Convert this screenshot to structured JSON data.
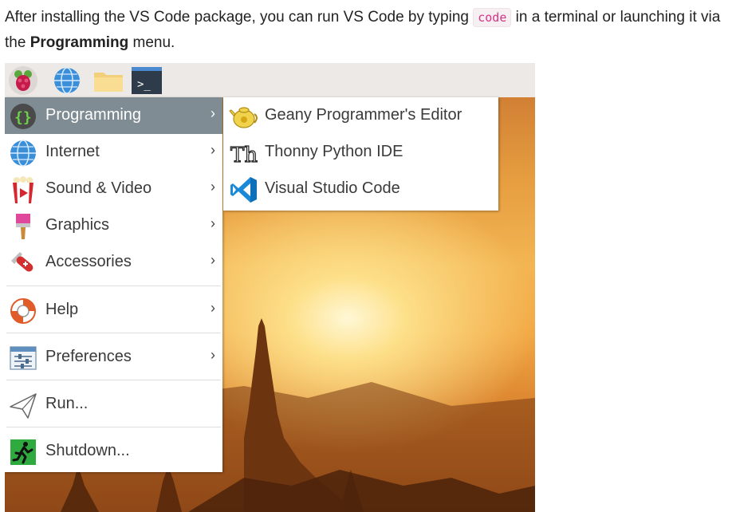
{
  "article": {
    "text_before_code": "After installing the VS Code package, you can run VS Code by typing ",
    "code": "code",
    "text_after_code": " in a terminal or launching it via the ",
    "menu_name": "Programming",
    "text_end": " menu."
  },
  "taskbar": {
    "icons": [
      "raspberry-pi-icon",
      "globe-icon",
      "folder-icon",
      "terminal-icon"
    ],
    "terminal_glyph": ">_"
  },
  "main_menu": {
    "items": [
      {
        "label": "Programming",
        "icon": "braces-icon",
        "has_submenu": true,
        "active": true
      },
      {
        "label": "Internet",
        "icon": "globe-icon",
        "has_submenu": true
      },
      {
        "label": "Sound & Video",
        "icon": "popcorn-icon",
        "has_submenu": true
      },
      {
        "label": "Graphics",
        "icon": "paintbrush-icon",
        "has_submenu": true
      },
      {
        "label": "Accessories",
        "icon": "swiss-knife-icon",
        "has_submenu": true
      },
      {
        "label": "Help",
        "icon": "lifebuoy-icon",
        "has_submenu": true
      },
      {
        "label": "Preferences",
        "icon": "sliders-icon",
        "has_submenu": true
      },
      {
        "label": "Run...",
        "icon": "paper-plane-icon",
        "has_submenu": false
      },
      {
        "label": "Shutdown...",
        "icon": "exit-running-man-icon",
        "has_submenu": false
      }
    ],
    "chevron": "›",
    "braces_glyph": "{}"
  },
  "submenu": {
    "items": [
      {
        "label": "Geany Programmer's Editor",
        "icon": "geany-teapot-icon"
      },
      {
        "label": "Thonny Python IDE",
        "icon": "thonny-icon"
      },
      {
        "label": "Visual Studio Code",
        "icon": "vscode-icon"
      }
    ],
    "thonny_glyph": "Th"
  },
  "colors": {
    "active_item_bg": "#7f8c93",
    "code_text": "#d63384",
    "vscode_blue": "#1a8ad8",
    "taskbar_bg": "#ede9e6"
  }
}
